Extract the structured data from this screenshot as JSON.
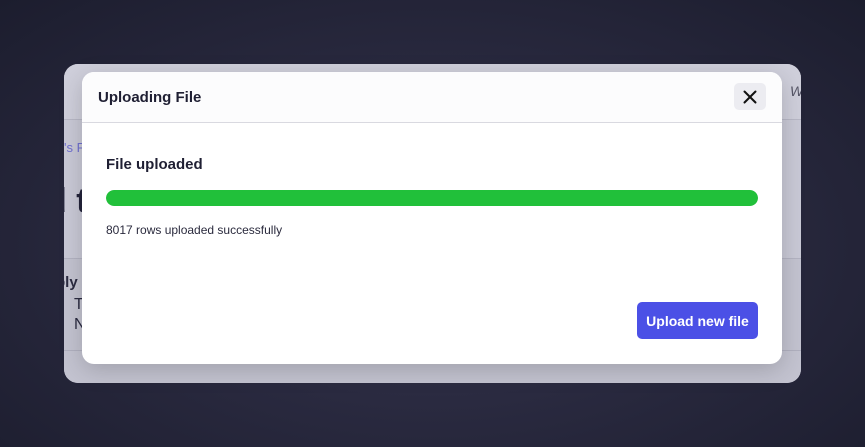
{
  "background": {
    "crumb": "'s F",
    "heading": "d t",
    "label": "bly",
    "row1": "T",
    "row2": "N",
    "topright": "W"
  },
  "modal": {
    "title": "Uploading File",
    "close_icon": "close-icon",
    "status_heading": "File uploaded",
    "progress_fraction": 1.0,
    "progress_color": "#21c03a",
    "status_message": "8017 rows uploaded successfully",
    "upload_new_label": "Upload new file",
    "button_color": "#4b50e6"
  }
}
